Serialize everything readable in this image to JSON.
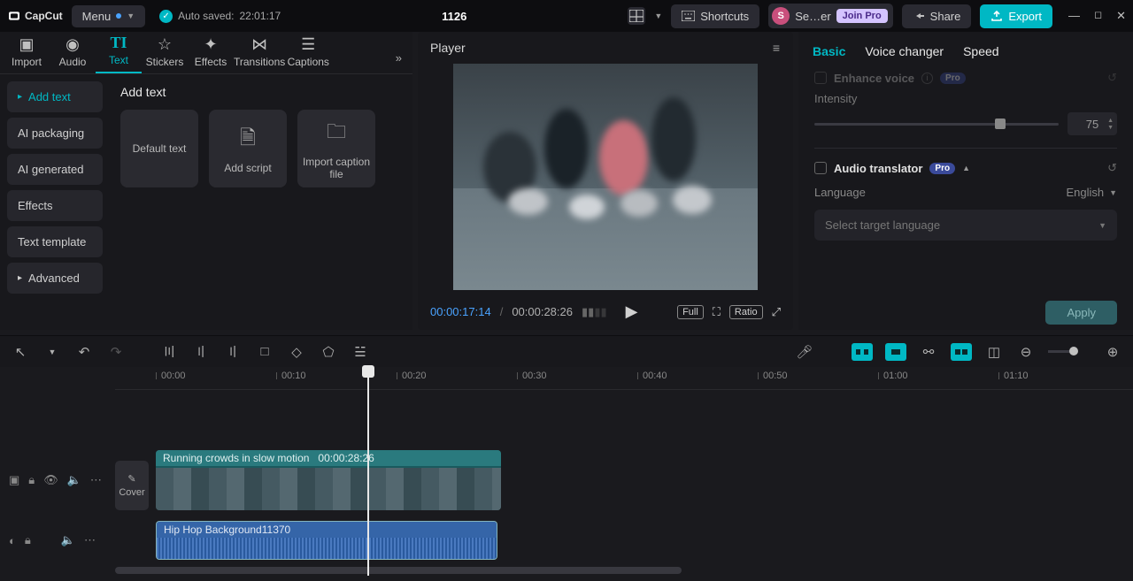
{
  "app": {
    "name": "CapCut"
  },
  "titlebar": {
    "menu": "Menu",
    "autosave_label": "Auto saved:",
    "autosave_time": "22:01:17",
    "project_name": "1126",
    "shortcuts": "Shortcuts",
    "user_short": "Se…er",
    "join_pro": "Join Pro",
    "share": "Share",
    "export": "Export"
  },
  "tabs": {
    "import": "Import",
    "audio": "Audio",
    "text": "Text",
    "stickers": "Stickers",
    "effects": "Effects",
    "transitions": "Transitions",
    "captions": "Captions"
  },
  "text_sidebar": {
    "add_text": "Add text",
    "ai_packaging": "AI packaging",
    "ai_generated": "AI generated",
    "effects": "Effects",
    "text_template": "Text template",
    "advanced": "Advanced"
  },
  "text_panel": {
    "heading": "Add text",
    "default_text": "Default text",
    "add_script": "Add script",
    "import_caption": "Import caption file"
  },
  "player": {
    "title": "Player",
    "current": "00:00:17:14",
    "duration": "00:00:28:26",
    "full": "Full",
    "ratio": "Ratio"
  },
  "right": {
    "tabs": {
      "basic": "Basic",
      "voice": "Voice changer",
      "speed": "Speed"
    },
    "enhance_voice": "Enhance voice",
    "intensity": "Intensity",
    "intensity_val": "75",
    "audio_translator": "Audio translator",
    "pro": "Pro",
    "language": "Language",
    "language_value": "English",
    "select_target": "Select target language",
    "apply": "Apply"
  },
  "timeline": {
    "ticks": [
      "00:00",
      "00:10",
      "00:20",
      "00:30",
      "00:40",
      "00:50",
      "01:00",
      "01:10"
    ],
    "cover": "Cover",
    "video_clip_name": "Running crowds in slow motion",
    "video_clip_dur": "00:00:28:26",
    "audio_clip_name": "Hip Hop Background11370"
  }
}
